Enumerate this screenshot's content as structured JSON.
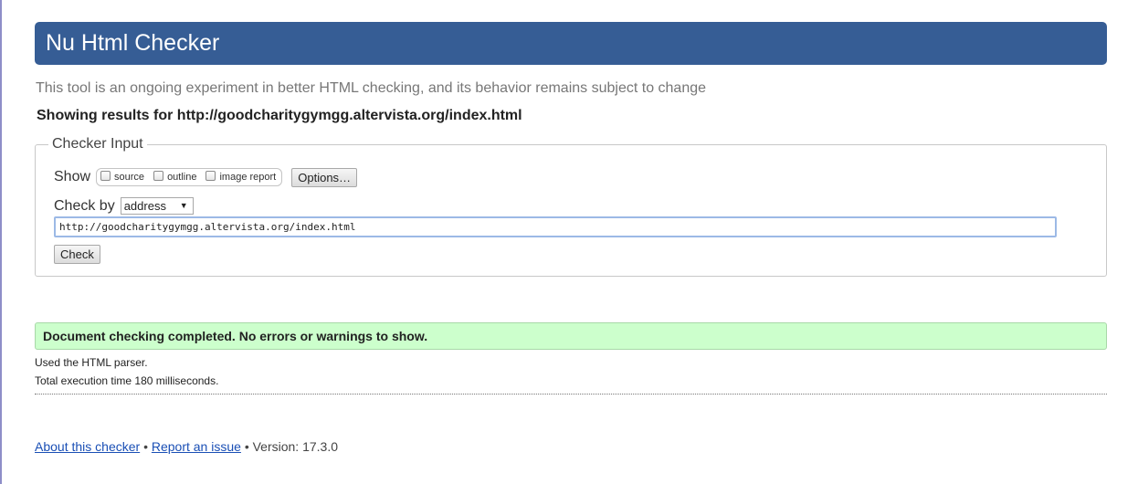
{
  "header": {
    "title": "Nu Html Checker"
  },
  "tagline": "This tool is an ongoing experiment in better HTML checking, and its behavior remains subject to change",
  "showing": "Showing results for http://goodcharitygymgg.altervista.org/index.html",
  "checker_input": {
    "legend": "Checker Input",
    "show_label": "Show",
    "options": [
      {
        "label": "source",
        "checked": false
      },
      {
        "label": "outline",
        "checked": false
      },
      {
        "label": "image report",
        "checked": false
      }
    ],
    "options_button": "Options…",
    "check_by_label": "Check by",
    "check_by_value": "address",
    "url_value": "http://goodcharitygymgg.altervista.org/index.html",
    "check_button": "Check"
  },
  "result": {
    "message": "Document checking completed. No errors or warnings to show.",
    "parser": "Used the HTML parser.",
    "timing": "Total execution time 180 milliseconds.",
    "status_color": "#ccffcc"
  },
  "footer": {
    "about_link": "About this checker",
    "sep1": "•",
    "report_link": "Report an issue",
    "sep2": "•",
    "version": "Version: 17.3.0"
  },
  "colors": {
    "header_bg": "#365d95",
    "link": "#1a4fb5"
  }
}
